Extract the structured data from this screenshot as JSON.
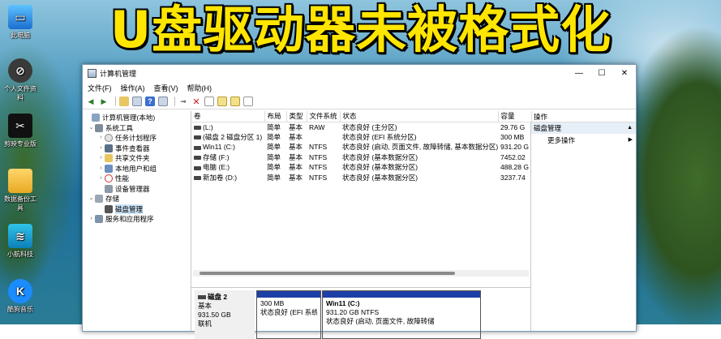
{
  "headline": "U盘驱动器未被格式化",
  "desktop_icons": [
    {
      "label": "此电脑",
      "icon": "this-pc-icon"
    },
    {
      "label": "个人文件资料",
      "icon": "personal-files-icon"
    },
    {
      "label": "剪映专业版",
      "icon": "capcut-icon"
    },
    {
      "label": "数据备份工具",
      "icon": "folder-icon"
    },
    {
      "label": "小航科技",
      "icon": "app-icon"
    },
    {
      "label": "酷狗音乐",
      "icon": "kugou-icon"
    }
  ],
  "window": {
    "title": "计算机管理",
    "controls": {
      "minimize": "—",
      "maximize": "☐",
      "close": "✕"
    }
  },
  "menu": [
    "文件(F)",
    "操作(A)",
    "查看(V)",
    "帮助(H)"
  ],
  "tree": [
    {
      "label": "计算机管理(本地)",
      "arrow": "",
      "level": 0,
      "icon": "computer-management-icon"
    },
    {
      "label": "系统工具",
      "arrow": "⌄",
      "level": 1,
      "icon": "system-tools-icon"
    },
    {
      "label": "任务计划程序",
      "arrow": "›",
      "level": 2,
      "icon": "task-scheduler-icon"
    },
    {
      "label": "事件查看器",
      "arrow": "›",
      "level": 2,
      "icon": "event-viewer-icon"
    },
    {
      "label": "共享文件夹",
      "arrow": "›",
      "level": 2,
      "icon": "shared-folder-icon"
    },
    {
      "label": "本地用户和组",
      "arrow": "›",
      "level": 2,
      "icon": "users-icon"
    },
    {
      "label": "性能",
      "arrow": "›",
      "level": 2,
      "icon": "performance-icon"
    },
    {
      "label": "设备管理器",
      "arrow": "",
      "level": 2,
      "icon": "device-manager-icon"
    },
    {
      "label": "存储",
      "arrow": "⌄",
      "level": 1,
      "icon": "storage-icon"
    },
    {
      "label": "磁盘管理",
      "arrow": "",
      "level": 2,
      "icon": "disk-management-icon",
      "selected": true
    },
    {
      "label": "服务和应用程序",
      "arrow": "›",
      "level": 1,
      "icon": "services-icon"
    }
  ],
  "volume_table": {
    "headers": [
      "卷",
      "布局",
      "类型",
      "文件系统",
      "状态",
      "容量"
    ],
    "rows": [
      [
        "(L:)",
        "简单",
        "基本",
        "RAW",
        "状态良好 (主分区)",
        "29.76 G"
      ],
      [
        "(磁盘 2 磁盘分区 1)",
        "简单",
        "基本",
        "",
        "状态良好 (EFI 系统分区)",
        "300 MB"
      ],
      [
        "Win11 (C:)",
        "简单",
        "基本",
        "NTFS",
        "状态良好 (启动, 页面文件, 故障转储, 基本数据分区)",
        "931.20 G"
      ],
      [
        "存储 (F:)",
        "简单",
        "基本",
        "NTFS",
        "状态良好 (基本数据分区)",
        "7452.02"
      ],
      [
        "电脑 (E:)",
        "简单",
        "基本",
        "NTFS",
        "状态良好 (基本数据分区)",
        "488.28 G"
      ],
      [
        "新加卷 (D:)",
        "简单",
        "基本",
        "NTFS",
        "状态良好 (基本数据分区)",
        "3237.74"
      ]
    ]
  },
  "disk_graph": {
    "disk_name": "磁盘 2",
    "disk_type": "基本",
    "disk_size": "931.50 GB",
    "disk_status": "联机",
    "partitions": [
      {
        "name": "",
        "size": "300 MB",
        "status": "状态良好 (EFI 系统"
      },
      {
        "name": "Win11 (C:)",
        "size": "931.20 GB NTFS",
        "status": "状态良好 (启动, 页面文件, 故障转储"
      }
    ]
  },
  "actions_pane": {
    "header": "操作",
    "section": "磁盘管理",
    "item": "更多操作"
  },
  "colors": {
    "headline": "#ffe600",
    "partition_bar": "#1e3fa8",
    "selection": "#cce4f7"
  }
}
